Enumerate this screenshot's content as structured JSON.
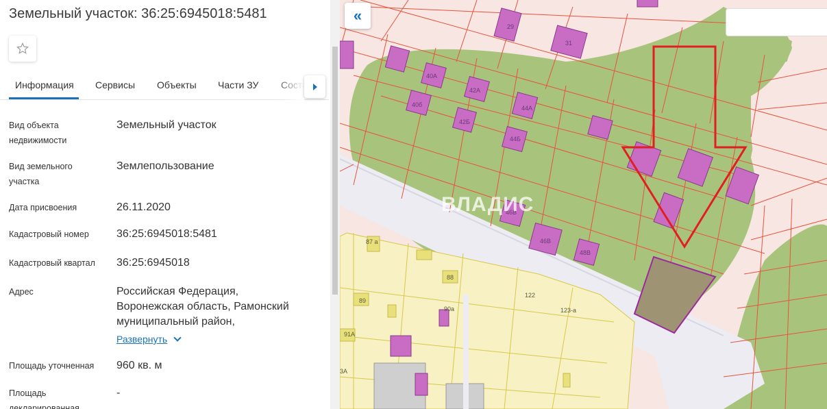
{
  "panel": {
    "title": "Земельный участок: 36:25:6945018:5481",
    "favorite_icon": "star-outline-icon",
    "tabs": [
      {
        "label": "Информация",
        "active": true
      },
      {
        "label": "Сервисы"
      },
      {
        "label": "Объекты"
      },
      {
        "label": "Части ЗУ"
      },
      {
        "label": "Соста"
      }
    ],
    "tab_scroll_icon": "caret-right-icon",
    "properties": [
      {
        "label": "Вид объекта недвижимости",
        "value": "Земельный участок"
      },
      {
        "label": "Вид земельного участка",
        "value": "Землепользование"
      },
      {
        "label": "Дата присвоения",
        "value": "26.11.2020"
      },
      {
        "label": "Кадастровый номер",
        "value": "36:25:6945018:5481"
      },
      {
        "label": "Кадастровый квартал",
        "value": "36:25:6945018"
      },
      {
        "label": "Адрес",
        "value_lines": [
          "Российская Федерация,",
          "Воронежская область, Рамонский",
          "муниципальный район,"
        ],
        "expand_label": "Развернуть"
      },
      {
        "label": "Площадь уточненная",
        "value": "960 кв. м"
      },
      {
        "label": "Площадь декларированная",
        "value": "-"
      }
    ]
  },
  "map": {
    "collapse_icon": "double-chevron-left-icon",
    "watermark": "ВЛАДИС",
    "colors": {
      "background": "#f7e6e2",
      "forest": "#a8c47c",
      "residential": "#f7f1c4",
      "road": "#ececf2",
      "parcel_border": "#e8523c",
      "building": "#c86cc4",
      "selected_parcel": "#9e9474",
      "arrow": "#e02020"
    },
    "parcel_labels": [
      "29",
      "31",
      "40А",
      "42А",
      "44А",
      "40б",
      "42Б",
      "44Б",
      "46В",
      "48В",
      "46В",
      "87 а",
      "88",
      "89",
      "90а",
      "91А",
      "122",
      "123-а",
      "3А"
    ]
  }
}
